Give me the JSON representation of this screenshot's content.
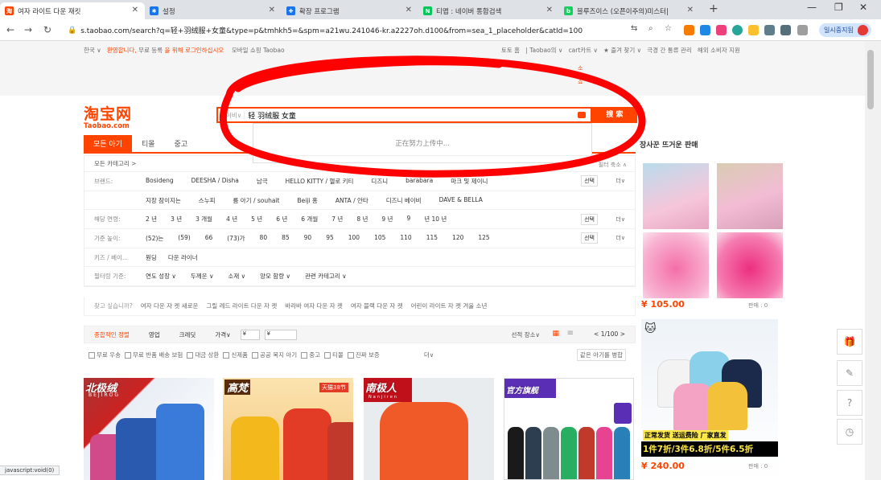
{
  "browser": {
    "tabs": [
      {
        "title": "여자 라이트 다운 재킷",
        "favicon": "taobao-icon",
        "color": "#f40"
      },
      {
        "title": "설정",
        "favicon": "gear-icon",
        "color": "#1a73e8"
      },
      {
        "title": "확장 프로그램",
        "favicon": "puzzle-icon",
        "color": "#1a73e8"
      },
      {
        "title": "티맵 : 네이버 통합검색",
        "favicon": "naver-icon",
        "color": "#03c75a"
      },
      {
        "title": "블루즈이스 (오픈이주의)미스터| ",
        "favicon": "blog-icon",
        "color": "#19ce60"
      }
    ],
    "url": "s.taobao.com/search?q=轻+羽绒服+女童&type=p&tmhkh5=&spm=a21wu.241046-kr.a2227oh.d100&from=sea_1_placeholder&catId=100",
    "profile_label": "일시중지됨",
    "profile_initial": "S",
    "status_text": "javascript:void(0)"
  },
  "site": {
    "topnav_left": [
      "한국",
      "환영합니다,",
      "무료 등록",
      "을 위해 로그인하십시오",
      "모바일 쇼핑 Taobao"
    ],
    "topnav_right": [
      "토토 홈",
      "| Taobao의",
      "cart카트",
      "★ 즐겨 찾기",
      "극경 간 통류 관리",
      "해외 소비자 지원"
    ],
    "shop_link": "소 쇼",
    "logo_cn": "淘宝网",
    "logo_en": "Taobao.com",
    "search_scope": "베이비∨",
    "search_query": "轻 羽绒服 女童",
    "search_button": "搜 索",
    "suggest_text": "正在努力上传中...",
    "category_tabs": [
      "모든 아기",
      "티몰",
      "중고"
    ],
    "all_categories": "모든 카테고리 >",
    "collapse_filter": "필터 축소 ∧",
    "filters": [
      {
        "label": "브랜드:",
        "values": [
          "Bosideng",
          "DEESHA / Disha",
          "남극",
          "HELLO KITTY / 헬로 키티",
          "디즈니",
          "barabara",
          "마크 및 제이니"
        ]
      },
      {
        "label": "",
        "values": [
          "지장 잠이지는",
          "스누피",
          "룸 아기 / souhait",
          "Beiji 홍",
          "ANTA / 안타",
          "디즈니 베이비",
          "DAVE & BELLA"
        ]
      },
      {
        "label": "해당 연령:",
        "values": [
          "2 년",
          "3 년",
          "3 개월",
          "4 년",
          "5 년",
          "6 년",
          "6 개월",
          "7 년",
          "8 년",
          "9 년",
          "9",
          "년 10 년"
        ]
      },
      {
        "label": "기준 높이:",
        "values": [
          "(52)는",
          "(59)",
          "66",
          "(73)가",
          "80",
          "85",
          "90",
          "95",
          "100",
          "105",
          "110",
          "115",
          "120",
          "125"
        ]
      },
      {
        "label": "키즈 / 베이...",
        "values": [
          "뭔딩",
          "다운 라이너"
        ]
      },
      {
        "label": "필터링 기준:",
        "values": [
          "연도 성장 ∨",
          "두께운 ∨",
          "소재 ∨",
          "양모 함량 ∨",
          "관련 카테고리 ∨"
        ]
      }
    ],
    "filter_select": "선택",
    "filter_more": "더∨",
    "related_label": "찾고 싶습니까?",
    "related": [
      "여자 다운 자 켓 새로운",
      "그릴 레드 라이트 다운 자 켓",
      "바라바 여자 다운 자 켓",
      "여자 블랙 다운 자 켓",
      "어린이 라이트 자 켓 겨울 소년"
    ],
    "sort_tabs": [
      "종합적인 정렬",
      "영업",
      "크레딧",
      "가격∨"
    ],
    "price_from": "¥",
    "price_to": "¥",
    "ship_from": "선적 장소∨",
    "pager": "<  1/100  >",
    "checks": [
      "무료 우송",
      "무료 반품 배송 보험",
      "대금 상환",
      "신제품",
      "공공 복지 아기",
      "중고",
      "티몰",
      "진짜 보증"
    ],
    "checks_more": "더∨",
    "delivery_btn": "같은 아기를 병합",
    "products": [
      {
        "badge": "北极绒",
        "sub": "BEJIROG"
      },
      {
        "badge": "高梵",
        "sub": "天猫38节"
      },
      {
        "badge": "南极人",
        "sub": "Nanjiren"
      },
      {
        "badge": "官方旗舰",
        "sub": ""
      }
    ],
    "side_title": "장사꾼 뜨거운 판매",
    "side_price1": "¥ 105.00",
    "side_sales1": "판매 : 0",
    "side_promo1": "正常发货 送运费险 厂家直发",
    "side_promo2": "1件7折/3件6.8折/5件6.5折",
    "side_price2": "¥ 240.00",
    "side_sales2": "판매 : 0",
    "tools": [
      "gift-icon",
      "edit-icon",
      "help-icon",
      "clock-icon"
    ]
  },
  "colors": {
    "brand": "#ff4400",
    "annotation": "#ff0000"
  }
}
